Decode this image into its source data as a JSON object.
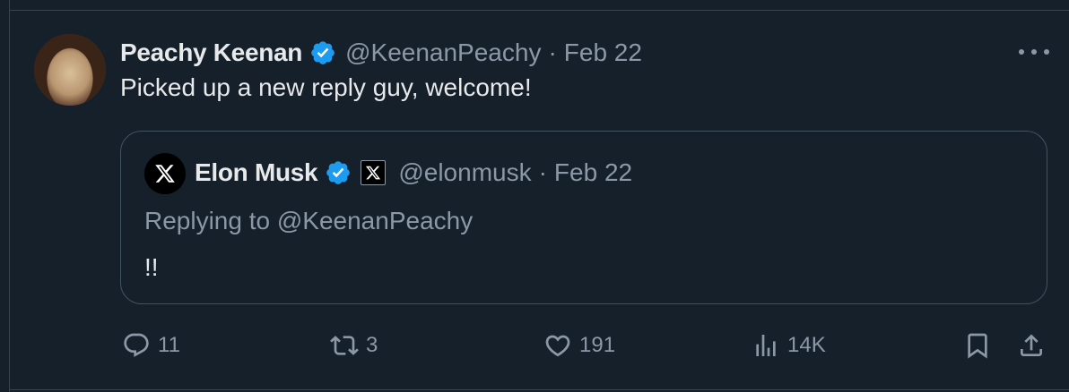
{
  "tweet": {
    "author_name": "Peachy Keenan",
    "author_handle": "@KeenanPeachy",
    "separator": "·",
    "date": "Feb 22",
    "text": "Picked up a new reply guy, welcome!"
  },
  "quoted": {
    "author_name": "Elon Musk",
    "author_handle": "@elonmusk",
    "separator": "·",
    "date": "Feb 22",
    "replying_to": "Replying to @KeenanPeachy",
    "text": "!!"
  },
  "actions": {
    "replies": "11",
    "reposts": "3",
    "likes": "191",
    "views": "14K"
  },
  "icons": [
    "verified-badge-icon",
    "more-icon",
    "x-logo-icon",
    "reply-icon",
    "repost-icon",
    "like-icon",
    "views-icon",
    "bookmark-icon",
    "share-icon"
  ],
  "colors": {
    "background": "#15202b",
    "verified": "#1d9bf0",
    "secondary_text": "#8b98a5",
    "primary_text": "#e7e9ea"
  }
}
